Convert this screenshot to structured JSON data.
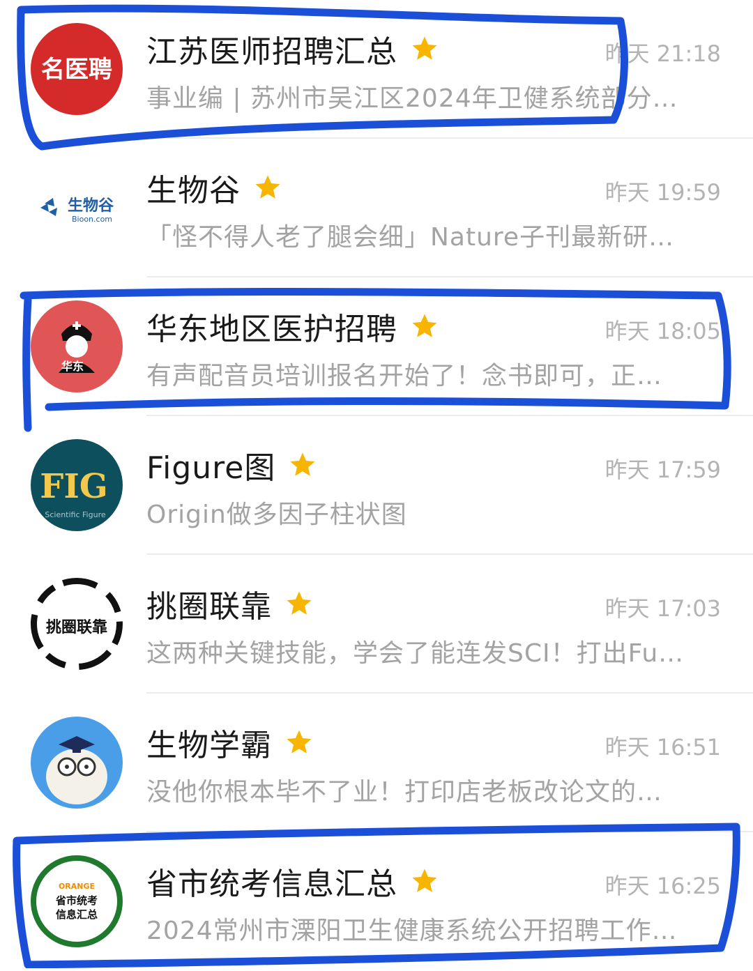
{
  "accounts": [
    {
      "name": "江苏医师招聘汇总",
      "time": "昨天 21:18",
      "preview": "事业编 | 苏州市吴江区2024年卫健系统部分…",
      "avatar_text": "名医聘",
      "starred": true,
      "avatar_color": "#d42a2a"
    },
    {
      "name": "生物谷",
      "time": "昨天 19:59",
      "preview": "「怪不得人老了腿会细」Nature子刊最新研…",
      "avatar_text": "生物谷",
      "avatar_subtext": "Bioon.com",
      "starred": true,
      "avatar_color": "#1e5fa8"
    },
    {
      "name": "华东地区医护招聘",
      "time": "昨天 18:05",
      "preview": "有声配音员培训报名开始了！念书即可，正…",
      "avatar_text": "华东",
      "starred": true,
      "avatar_color": "#e05555"
    },
    {
      "name": "Figure图",
      "time": "昨天 17:59",
      "preview": "Origin做多因子柱状图",
      "avatar_text": "FIG",
      "avatar_subtext": "Scientific Figure",
      "starred": true,
      "avatar_color": "#0e4f5e"
    },
    {
      "name": "挑圈联靠",
      "time": "昨天 17:03",
      "preview": "这两种关键技能，学会了能连发SCI！打出Fu…",
      "avatar_text": "挑圈联靠",
      "starred": true,
      "avatar_color": "#ffffff"
    },
    {
      "name": "生物学霸",
      "time": "昨天 16:51",
      "preview": "没他你根本毕不了业！打印店老板改论文的…",
      "avatar_text": "",
      "starred": true,
      "avatar_color": "#4a9ee8"
    },
    {
      "name": "省市统考信息汇总",
      "time": "昨天 16:25",
      "preview": "2024常州市溧阳卫生健康系统公开招聘工作…",
      "avatar_text": "省市统考信息汇总",
      "avatar_subtext": "ORANGE",
      "starred": true,
      "avatar_color": "#1f7a2e"
    }
  ],
  "colors": {
    "star": "#f7b500",
    "marker": "#1b4fd8"
  }
}
